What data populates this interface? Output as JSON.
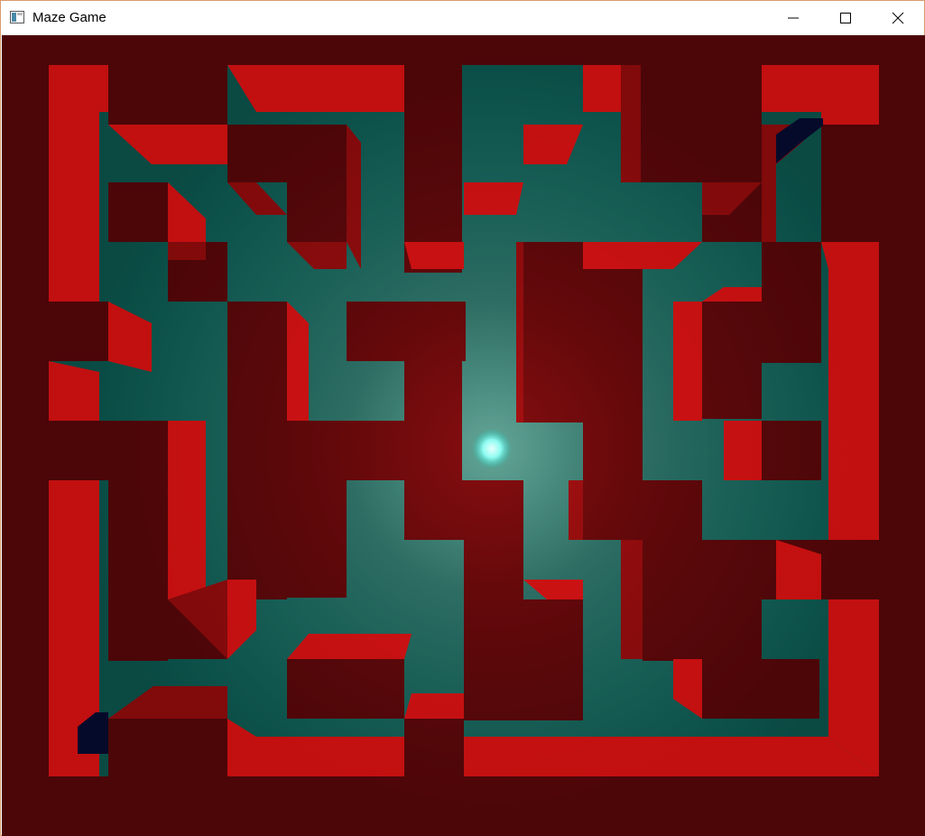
{
  "window": {
    "title": "Maze Game",
    "app_icon": "window-app-icon",
    "controls": {
      "minimize_icon": "minimize-icon",
      "maximize_icon": "maximize-icon",
      "close_icon": "close-icon"
    }
  },
  "game": {
    "colors": {
      "background": "#470607",
      "wall_top": "#4c0608",
      "wall_face_bright": "#c20f10",
      "wall_face_dark": "#810a0b",
      "floor": "#0a4a43",
      "floor_glow": "#14a394",
      "light": "#a8fff8",
      "start_marker": "#060a2a",
      "goal_marker": "#060a2a"
    },
    "light_icon": "glowing-light-orb",
    "markers": [
      "start-marker",
      "goal-marker"
    ]
  }
}
